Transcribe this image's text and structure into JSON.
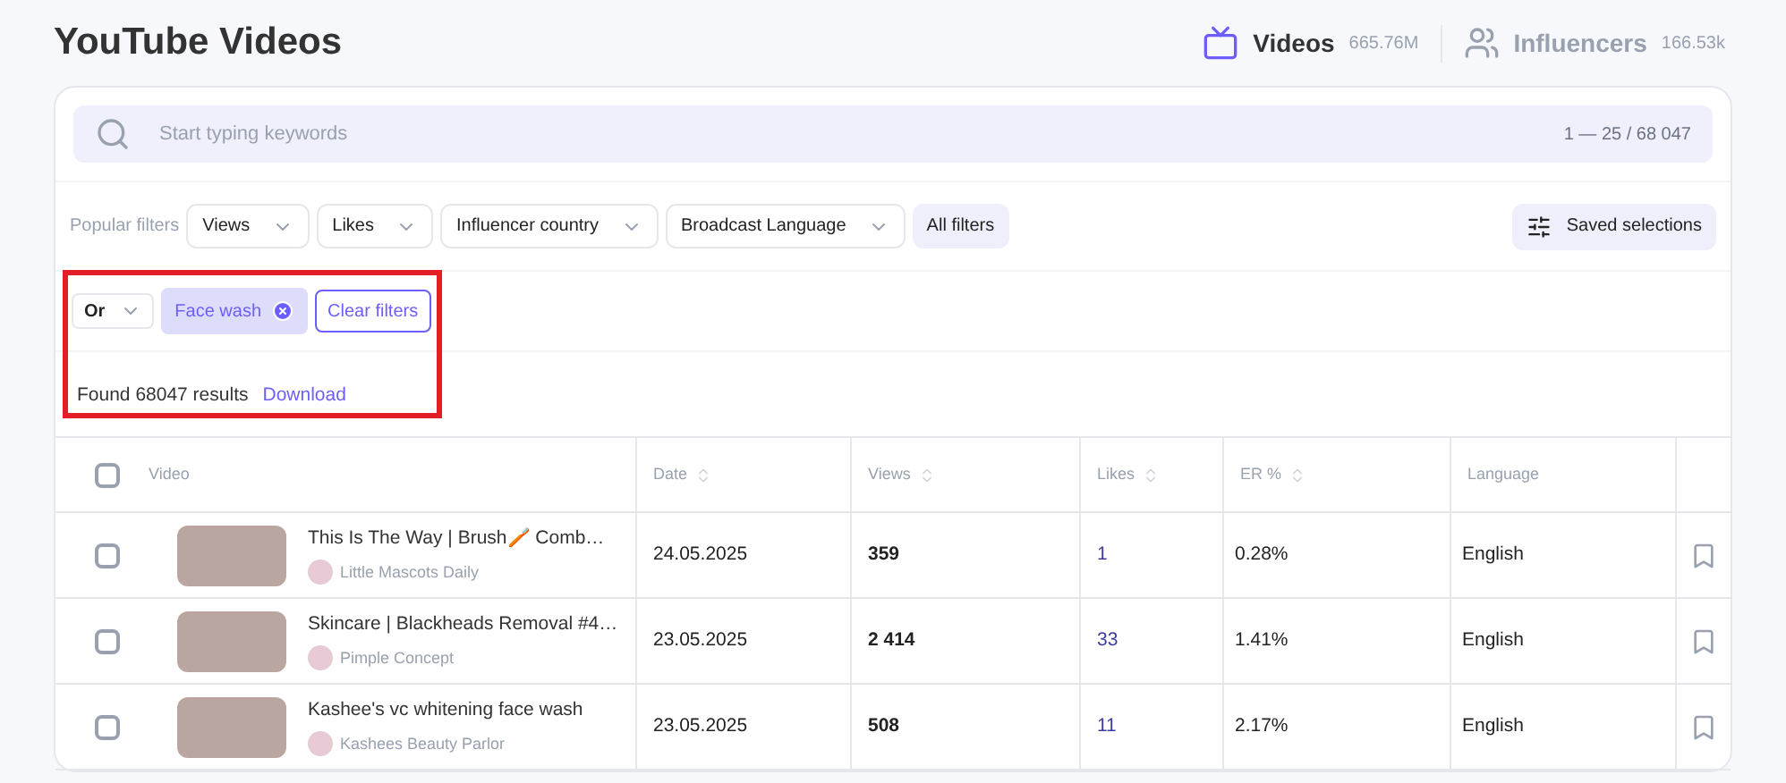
{
  "page_title": "YouTube Videos",
  "source_tabs": [
    {
      "kind": "video",
      "label": "Videos",
      "count": "665.76M",
      "selected": true
    },
    {
      "kind": "people",
      "label": "Influencers",
      "count": "166.53k",
      "selected": false
    }
  ],
  "search": {
    "placeholder": "Start typing keywords",
    "range": "1 — 25 / 68 047"
  },
  "popular_filters": {
    "label": "Popular filters",
    "dropdowns": [
      "Views",
      "Likes",
      "Influencer country",
      "Broadcast Language"
    ],
    "all_filters": "All filters",
    "saved_selections": "Saved selections"
  },
  "active_filters": {
    "operator": "Or",
    "tags": [
      "Face wash"
    ],
    "clear": "Clear filters"
  },
  "results": {
    "found": "Found 68047 results",
    "download": "Download"
  },
  "table": {
    "select_all_checked": false,
    "columns": [
      {
        "label": "Video",
        "sortable": false
      },
      {
        "label": "Date",
        "sortable": true
      },
      {
        "label": "Views",
        "sortable": true
      },
      {
        "label": "Likes",
        "sortable": true
      },
      {
        "label": "ER %",
        "sortable": true
      },
      {
        "label": "Language",
        "sortable": false
      }
    ],
    "rows": [
      {
        "checked": false,
        "title": "This Is The Way | Brush🪥 Comb…",
        "channel": "Little Mascots Daily",
        "date": "24.05.2025",
        "views": "359",
        "likes": "1",
        "er": "0.28%",
        "language": "English"
      },
      {
        "checked": false,
        "title": "Skincare | Blackheads Removal #4…",
        "channel": "Pimple Concept",
        "date": "23.05.2025",
        "views": "2 414",
        "likes": "33",
        "er": "1.41%",
        "language": "English"
      },
      {
        "checked": false,
        "title": "Kashee's vc whitening face wash",
        "channel": "Kashees Beauty Parlor",
        "date": "23.05.2025",
        "views": "508",
        "likes": "11",
        "er": "2.17%",
        "language": "English"
      }
    ]
  }
}
